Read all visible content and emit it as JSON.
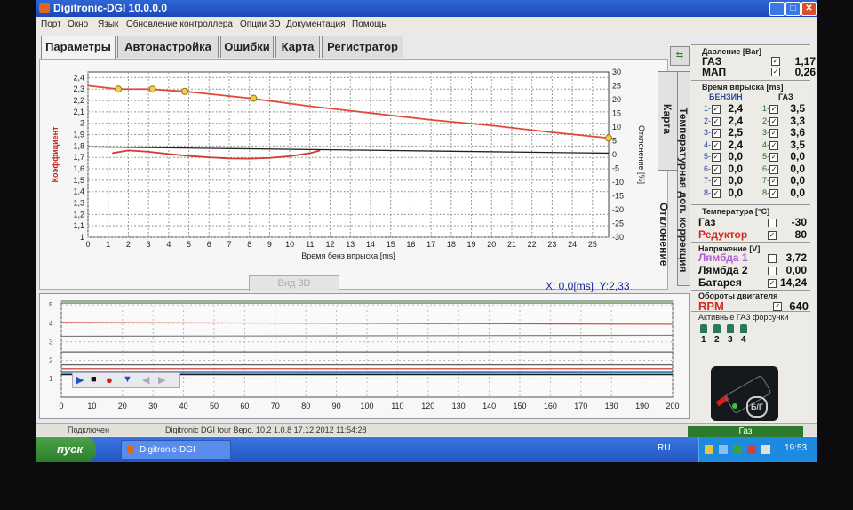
{
  "window": {
    "title": "Digitronic-DGI  10.0.0.0"
  },
  "menu": [
    "Порт",
    "Окно",
    "Язык",
    "Обновление контроллера",
    "Опции 3D",
    "Документация",
    "Помощь"
  ],
  "tabs": [
    "Параметры",
    "Автонастройка",
    "Ошибки",
    "Карта",
    "Регистратор"
  ],
  "side_tabs": [
    "Карта",
    "Температурная доп. коррекция",
    "Отклонение"
  ],
  "view3d_label": "Вид 3D",
  "cursor_readout": {
    "x": "X:  0,0[ms]",
    "y": "Y:2,33"
  },
  "chart_data": {
    "type": "line",
    "xlabel": "Время бенз впрыска [ms]",
    "ylabel": "Коэффициент",
    "y2label": "Отклонение [%]",
    "xticks": [
      "0",
      "1",
      "2",
      "3",
      "4",
      "5",
      "6",
      "7",
      "8",
      "9",
      "10",
      "11",
      "12",
      "13",
      "14",
      "15",
      "16",
      "17",
      "18",
      "19",
      "20",
      "21",
      "22",
      "23",
      "24",
      "25"
    ],
    "yticks": [
      "1",
      "1,1",
      "1,2",
      "1,3",
      "1,4",
      "1,5",
      "1,6",
      "1,7",
      "1,8",
      "1,9",
      "2",
      "2,1",
      "2,2",
      "2,3",
      "2,4"
    ],
    "y2ticks": [
      "30",
      "25",
      "20",
      "15",
      "10",
      "5",
      "0",
      "-5",
      "-10",
      "-15",
      "-20",
      "-25",
      "-30"
    ],
    "xlim": [
      0,
      25.8
    ],
    "ylim": [
      1.0,
      2.45
    ],
    "y2lim": [
      -30,
      30
    ],
    "grid": true,
    "series": [
      {
        "role": "coefficient",
        "color": "#e04a3a",
        "x": [
          0,
          1.5,
          3,
          4.8,
          8,
          11,
          14,
          17,
          20,
          23,
          25.8
        ],
        "y": [
          2.33,
          2.3,
          2.3,
          2.28,
          2.22,
          2.15,
          2.09,
          2.03,
          1.98,
          1.92,
          1.87
        ]
      },
      {
        "role": "deviation",
        "color": "#d03a30",
        "x": [
          1.2,
          2,
          3,
          4,
          5,
          6,
          7,
          8,
          9,
          10,
          11,
          11.5
        ],
        "y2": [
          0.5,
          1.5,
          1.0,
          0.2,
          -0.5,
          -1.0,
          -1.4,
          -1.5,
          -1.2,
          -0.6,
          0.5,
          1.5
        ]
      },
      {
        "role": "zero-line",
        "color": "#222222",
        "x": [
          0,
          25.8
        ],
        "y2": [
          2.8,
          0.5
        ]
      }
    ],
    "points": [
      {
        "x": 1.5,
        "y": 2.3
      },
      {
        "x": 3.2,
        "y": 2.3
      },
      {
        "x": 4.8,
        "y": 2.28
      },
      {
        "x": 8.2,
        "y": 2.22
      },
      {
        "x": 25.8,
        "y": 1.87
      }
    ]
  },
  "logger": {
    "yticks": [
      "5",
      "4",
      "3",
      "2",
      "1"
    ],
    "xticks": [
      "0",
      "10",
      "20",
      "30",
      "40",
      "50",
      "60",
      "70",
      "80",
      "90",
      "100",
      "110",
      "120",
      "130",
      "140",
      "150",
      "160",
      "170",
      "180",
      "190",
      "200"
    ],
    "ylim": [
      0,
      5.2
    ],
    "xlim": [
      0,
      200
    ],
    "traces": [
      {
        "color": "#2e8b2e",
        "values": [
          5.1,
          5.1
        ]
      },
      {
        "color": "#d05040",
        "values": [
          4.05,
          3.95
        ]
      },
      {
        "color": "#808080",
        "values": [
          3.3,
          3.35
        ]
      },
      {
        "color": "#606060",
        "values": [
          2.45,
          2.45
        ]
      },
      {
        "color": "#606060",
        "values": [
          1.75,
          1.75
        ]
      },
      {
        "color": "#c03030",
        "values": [
          1.55,
          1.55
        ]
      },
      {
        "color": "#2a50c0",
        "values": [
          1.35,
          1.35
        ]
      },
      {
        "color": "#40a0a0",
        "values": [
          1.28,
          1.3
        ]
      },
      {
        "color": "#1a1a1a",
        "values": [
          1.22,
          1.22
        ]
      }
    ]
  },
  "pressure": {
    "title": "Давление [Bar]",
    "rows": [
      {
        "label": "ГАЗ",
        "checked": true,
        "value": "1,17"
      },
      {
        "label": "МАП",
        "checked": true,
        "value": "0,26"
      }
    ]
  },
  "injection": {
    "title": "Время впрыска [ms]",
    "col_benzin": "БЕНЗИН",
    "col_gaz": "ГАЗ",
    "benzin": [
      {
        "n": "1",
        "value": "2,4",
        "checked": true
      },
      {
        "n": "2",
        "value": "2,4",
        "checked": true
      },
      {
        "n": "3",
        "value": "2,5",
        "checked": true
      },
      {
        "n": "4",
        "value": "2,4",
        "checked": true
      },
      {
        "n": "5",
        "value": "0,0",
        "checked": true
      },
      {
        "n": "6",
        "value": "0,0",
        "checked": true
      },
      {
        "n": "7",
        "value": "0,0",
        "checked": true
      },
      {
        "n": "8",
        "value": "0,0",
        "checked": true
      }
    ],
    "gaz": [
      {
        "n": "1",
        "value": "3,5",
        "checked": true
      },
      {
        "n": "2",
        "value": "3,3",
        "checked": true
      },
      {
        "n": "3",
        "value": "3,6",
        "checked": true
      },
      {
        "n": "4",
        "value": "3,5",
        "checked": true
      },
      {
        "n": "5",
        "value": "0,0",
        "checked": true
      },
      {
        "n": "6",
        "value": "0,0",
        "checked": true
      },
      {
        "n": "7",
        "value": "0,0",
        "checked": true
      },
      {
        "n": "8",
        "value": "0,0",
        "checked": true
      }
    ]
  },
  "temperature": {
    "title": "Температура  [°C]",
    "rows": [
      {
        "label": "Газ",
        "checked": false,
        "value": "-30",
        "color": "#111111"
      },
      {
        "label": "Редуктор",
        "checked": true,
        "value": "80",
        "color": "#d02a20"
      }
    ]
  },
  "voltage": {
    "title": "Напряжение [V]",
    "rows": [
      {
        "label": "Лямбда 1",
        "checked": false,
        "value": "3,72",
        "color": "#b060d0"
      },
      {
        "label": "Лямбда 2",
        "checked": false,
        "value": "0,00",
        "color": "#111111"
      },
      {
        "label": "Батарея",
        "checked": true,
        "value": "14,24",
        "color": "#111111"
      }
    ]
  },
  "rpm": {
    "title": "Обороты двигателя",
    "label": "RPM",
    "checked": true,
    "value": "640"
  },
  "active_injectors": {
    "title": "Активные ГАЗ форсунки",
    "numbers": [
      "1",
      "2",
      "3",
      "4"
    ]
  },
  "switch": {
    "label": "Б/Г"
  },
  "statusbar": {
    "connection": "Подключен",
    "info": "Digitronic DGI four   Верс. 10.2  1.0.8   17.12.2012 11:54:28"
  },
  "gaz_state": "Газ",
  "taskbar": {
    "start": "пуск",
    "task": "Digitronic-DGI",
    "lang": "RU",
    "clock": "19:53"
  },
  "colors": {
    "accent": "#2456c4",
    "curve": "#e04a3a",
    "point": "#f0d040",
    "trace_green": "#2e8b2e"
  }
}
